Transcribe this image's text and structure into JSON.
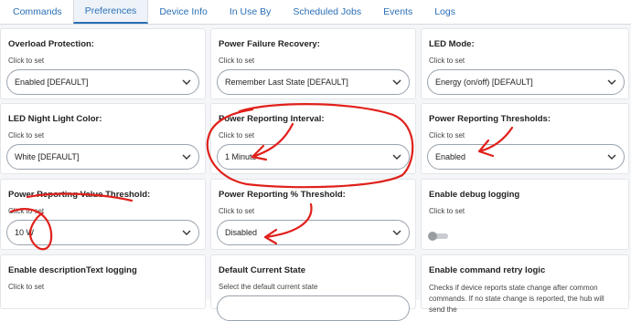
{
  "tabs": [
    "Commands",
    "Preferences",
    "Device Info",
    "In Use By",
    "Scheduled Jobs",
    "Events",
    "Logs"
  ],
  "active_tab": "Preferences",
  "cards": {
    "overload": {
      "title": "Overload Protection:",
      "hint": "Click to set",
      "value": "Enabled [DEFAULT]"
    },
    "power_failure": {
      "title": "Power Failure Recovery:",
      "hint": "Click to set",
      "value": "Remember Last State [DEFAULT]"
    },
    "led_mode": {
      "title": "LED Mode:",
      "hint": "Click to set",
      "value": "Energy (on/off) [DEFAULT]"
    },
    "led_night": {
      "title": "LED Night Light Color:",
      "hint": "Click to set",
      "value": "White [DEFAULT]"
    },
    "power_interval": {
      "title": "Power Reporting Interval:",
      "hint": "Click to set",
      "value": "1 Minute"
    },
    "power_thresholds": {
      "title": "Power Reporting Thresholds:",
      "hint": "Click to set",
      "value": "Enabled"
    },
    "power_value": {
      "title": "Power Reporting Value Threshold:",
      "hint": "Click to set",
      "value": "10 W"
    },
    "power_percent": {
      "title": "Power Reporting % Threshold:",
      "hint": "Click to set",
      "value": "Disabled"
    },
    "debug": {
      "title": "Enable debug logging",
      "hint": "Click to set"
    },
    "desc_text": {
      "title": "Enable descriptionText logging",
      "hint": "Click to set"
    },
    "default_state": {
      "title": "Default Current State",
      "hint": "Select the default current state"
    },
    "retry": {
      "title": "Enable command retry logic",
      "hint": "Checks if device reports state change after common commands. If no state change is reported, the hub will send the"
    }
  },
  "colors": {
    "accent": "#2a6fb6",
    "annotation": "#e0201b"
  }
}
